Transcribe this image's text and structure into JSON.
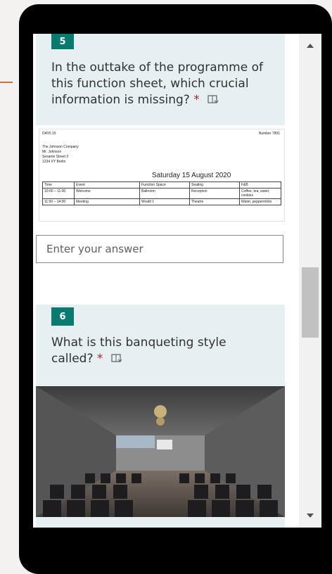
{
  "question5": {
    "number": "5",
    "text": "In the outtake of the programme of this function sheet, which crucial information is missing?",
    "required_mark": "*"
  },
  "function_sheet": {
    "company_code": "DAY5 15",
    "number_label": "Number 7891",
    "address": [
      "The Johnson Company",
      "Mr. Johnson",
      "Sesame Street 2",
      "1234 XY Berlin"
    ],
    "date": "Saturday 15 August 2020",
    "columns": [
      "Time",
      "Event",
      "Function Space",
      "Seating",
      "F&B"
    ],
    "rows": [
      [
        "10:00 – 11:00",
        "Welcome",
        "Ballroom",
        "Reception",
        "Coffee, tea, water, cookies"
      ],
      [
        "11:00 – 14:00",
        "Meeting",
        "Wvald 1",
        "Theatre",
        "Water, peppermints"
      ]
    ]
  },
  "answer": {
    "placeholder": "Enter your answer"
  },
  "question6": {
    "number": "6",
    "text": "What is this banqueting style called?",
    "required_mark": "*"
  },
  "colors": {
    "accent": "#087a6f",
    "card_bg": "#e6f0f2",
    "required": "#a4262c"
  },
  "icons": [
    "immersive-reader-icon",
    "scroll-up-arrow-icon",
    "scroll-down-arrow-icon"
  ]
}
